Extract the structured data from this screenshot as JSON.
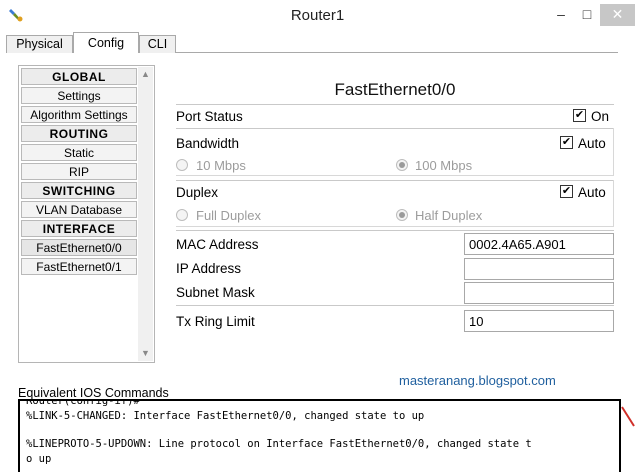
{
  "window": {
    "title": "Router1",
    "minimize_label": "–",
    "maximize_label": "□",
    "close_label": "✕"
  },
  "tabs": [
    {
      "label": "Physical",
      "active": false
    },
    {
      "label": "Config",
      "active": true
    },
    {
      "label": "CLI",
      "active": false
    }
  ],
  "nav": {
    "items": [
      {
        "label": "GLOBAL",
        "header": true
      },
      {
        "label": "Settings",
        "header": false
      },
      {
        "label": "Algorithm Settings",
        "header": false
      },
      {
        "label": "ROUTING",
        "header": true
      },
      {
        "label": "Static",
        "header": false
      },
      {
        "label": "RIP",
        "header": false
      },
      {
        "label": "SWITCHING",
        "header": true
      },
      {
        "label": "VLAN Database",
        "header": false
      },
      {
        "label": "INTERFACE",
        "header": true
      },
      {
        "label": "FastEthernet0/0",
        "header": false
      },
      {
        "label": "FastEthernet0/1",
        "header": false
      }
    ],
    "scroll_up": "▲",
    "scroll_down": "▼"
  },
  "interface": {
    "title": "FastEthernet0/0",
    "port_status": {
      "label": "Port Status",
      "check_label": "On",
      "checked": true
    },
    "bandwidth": {
      "label": "Bandwidth",
      "check_label": "Auto",
      "checked": true,
      "options": [
        {
          "label": "10 Mbps",
          "selected": false
        },
        {
          "label": "100 Mbps",
          "selected": true
        }
      ]
    },
    "duplex": {
      "label": "Duplex",
      "check_label": "Auto",
      "checked": true,
      "options": [
        {
          "label": "Full Duplex",
          "selected": false
        },
        {
          "label": "Half Duplex",
          "selected": true
        }
      ]
    },
    "mac": {
      "label": "MAC Address",
      "value": "0002.4A65.A901"
    },
    "ip": {
      "label": "IP Address",
      "value": ""
    },
    "subnet": {
      "label": "Subnet Mask",
      "value": ""
    },
    "tx_ring": {
      "label": "Tx Ring Limit",
      "value": "10"
    }
  },
  "watermark": "masteranang.blogspot.com",
  "ios": {
    "label": "Equivalent IOS Commands",
    "lines": [
      "Router(config-if)#",
      "%LINK-5-CHANGED: Interface FastEthernet0/0, changed state to up",
      "",
      "%LINEPROTO-5-UPDOWN: Line protocol on Interface FastEthernet0/0, changed state t",
      "o up"
    ]
  },
  "colors": {
    "watermark": "#1f5f9e",
    "annotation_red": "#d0302a"
  }
}
